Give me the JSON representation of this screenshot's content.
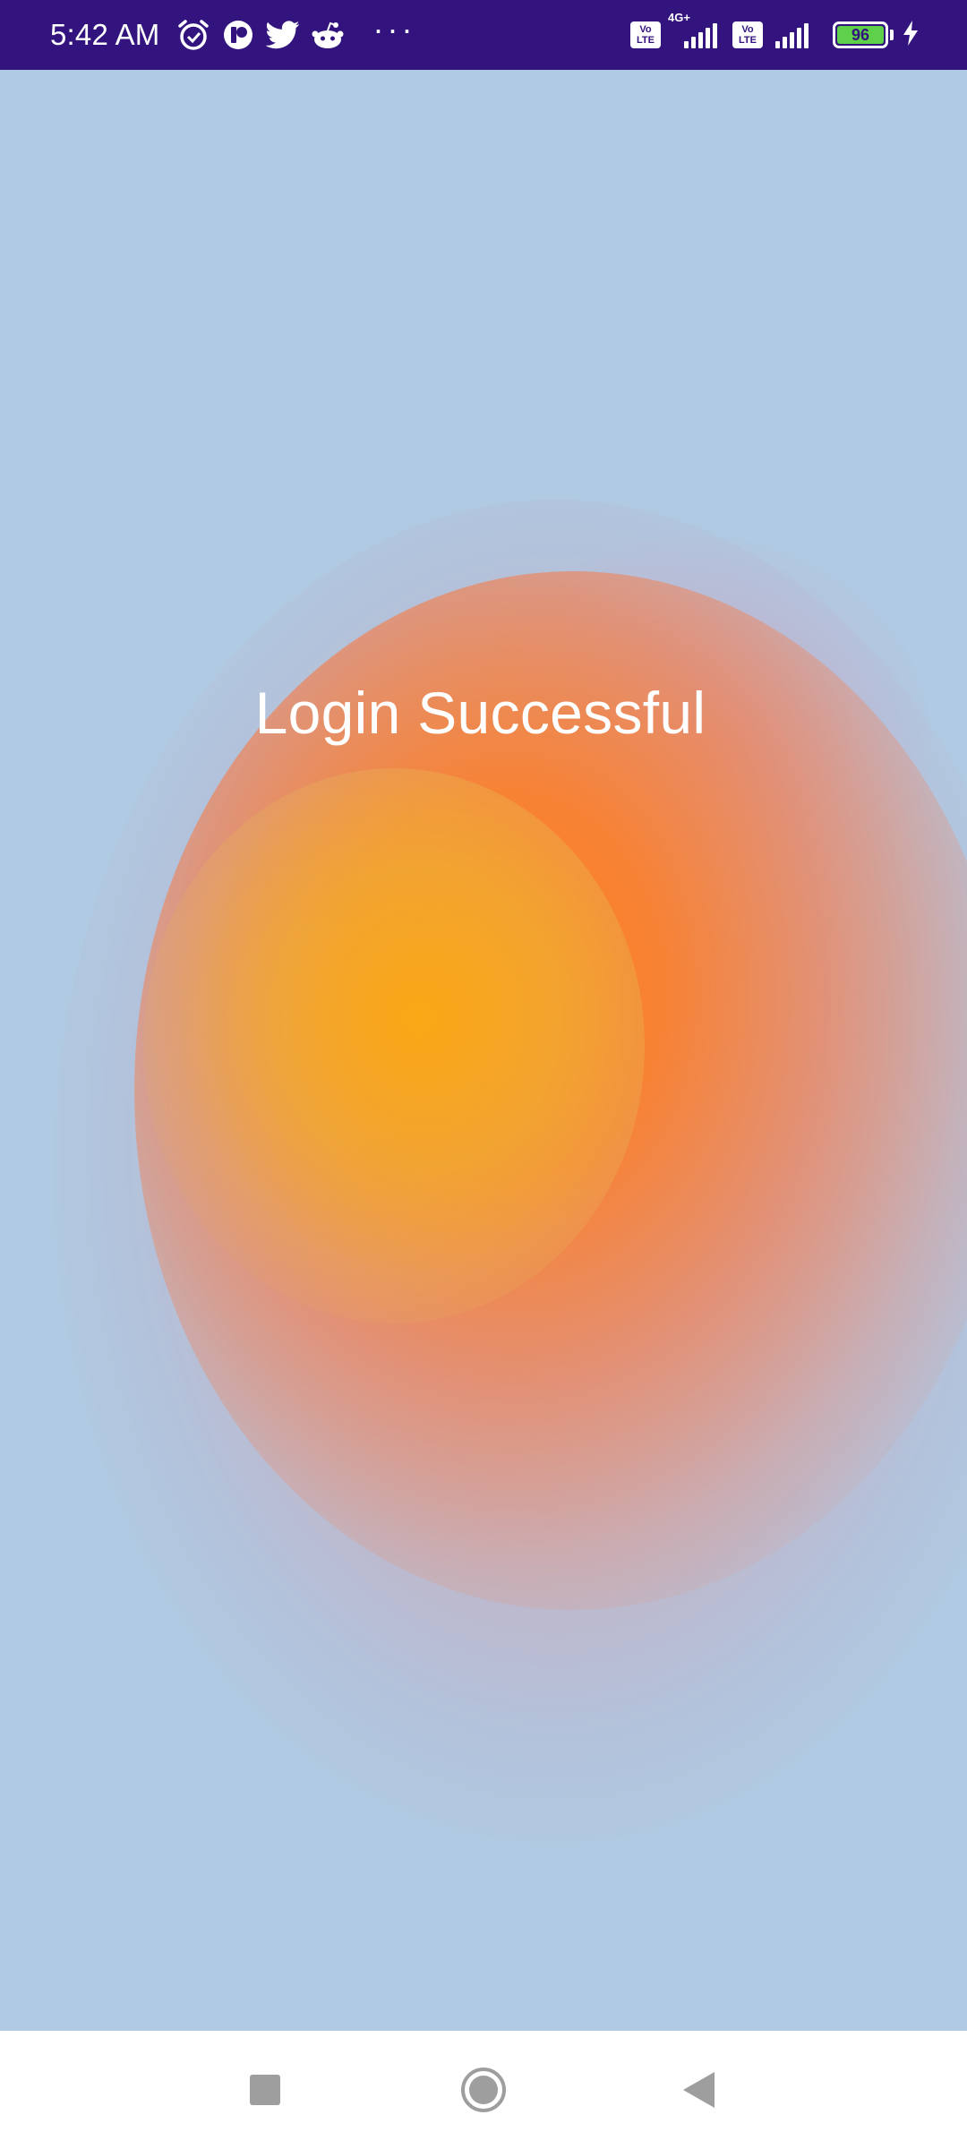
{
  "status_bar": {
    "time": "5:42 AM",
    "left_icons": [
      "alarm-icon",
      "app-icon",
      "twitter-icon",
      "reddit-icon"
    ],
    "more": "···",
    "volte_1": [
      "Vo",
      "LTE"
    ],
    "network_type": "4G+",
    "volte_2": [
      "Vo",
      "LTE"
    ],
    "battery_level": "96",
    "charging": true,
    "bg_color": "#33147e",
    "battery_color": "#5fd04a"
  },
  "main": {
    "message": "Login Successful",
    "bg_color": "#b0cae3"
  },
  "nav_bar": {
    "buttons": [
      "recents-button",
      "home-button",
      "back-button"
    ]
  }
}
